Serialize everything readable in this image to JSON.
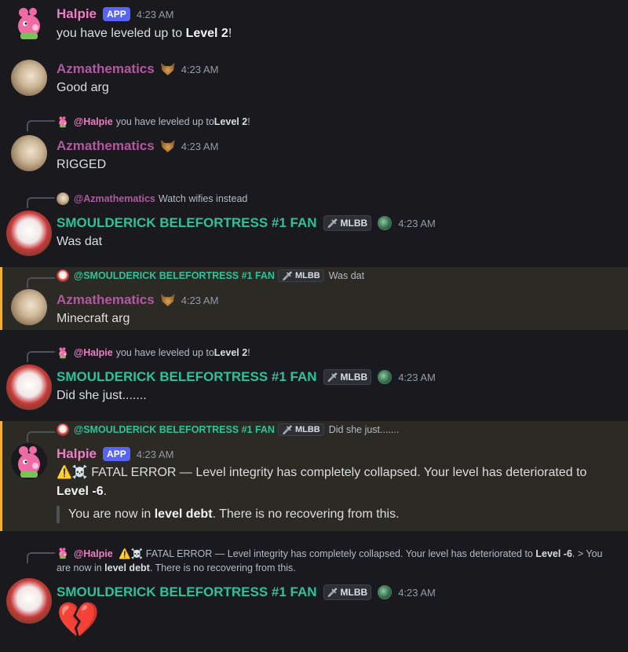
{
  "users": {
    "halpie": "Halpie",
    "az": "Azmathematics",
    "smoul": "SMOULDERICK BELEFORTRESS #1 FAN"
  },
  "badges": {
    "app": "APP",
    "mlbb": "MLBB"
  },
  "time": "4:23 AM",
  "colors": {
    "halpie": "#ec7ec4",
    "az": "#b05a9e",
    "smoul": "#2fc199",
    "mention_bar": "#f0b232",
    "app_badge": "#5865f2"
  },
  "m1": {
    "text_pre": "you have leveled up to ",
    "text_bold": "Level 2",
    "text_post": "!"
  },
  "m2": {
    "text": "Good arg"
  },
  "m3": {
    "reply_name": "@Halpie",
    "reply_pre": "you have leveled up to ",
    "reply_bold": "Level 2",
    "reply_post": "!",
    "text": "RIGGED"
  },
  "m4": {
    "reply_name": "@Azmathematics",
    "reply_text": "Watch wifies instead",
    "text": "Was dat"
  },
  "m5": {
    "reply_name": "@SMOULDERICK BELEFORTRESS #1 FAN",
    "reply_text": "Was dat",
    "text": "Minecraft arg"
  },
  "m6": {
    "reply_name": "@Halpie",
    "reply_pre": "you have leveled up to ",
    "reply_bold": "Level 2",
    "reply_post": "!",
    "text": "Did she just......."
  },
  "m7": {
    "reply_name": "@SMOULDERICK BELEFORTRESS #1 FAN",
    "reply_text": "Did she just.......",
    "line1_emoji": "⚠️☠️",
    "line1_text": " FATAL ERROR — Level integrity has completely collapsed. Your level has deteriorated to ",
    "line1_bold": "Level -6",
    "line1_post": ".",
    "quote_pre": "You are now in ",
    "quote_bold": "level debt",
    "quote_post": ". There is no recovering from this."
  },
  "m8": {
    "reply_name": "@Halpie",
    "reply_emoji": "⚠️☠️",
    "reply_text1": " FATAL ERROR — Level integrity has completely collapsed. Your level has deteriorated to ",
    "reply_bold1": "Level -6",
    "reply_text2": ".  > You are now in ",
    "reply_bold2": "level debt",
    "reply_text3": ". There is no recovering from this.",
    "emoji": "💔"
  },
  "icons": {
    "sword": "sword-icon",
    "guild": "guild-globe-icon",
    "animal": "wolf-role-icon"
  }
}
